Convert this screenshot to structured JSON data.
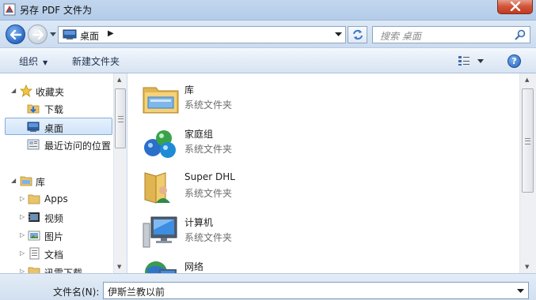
{
  "window": {
    "title": "另存 PDF 文件为"
  },
  "address": {
    "breadcrumb": "桌面",
    "search_placeholder": "搜索 桌面"
  },
  "toolbar": {
    "organize": "组织",
    "new_folder": "新建文件夹"
  },
  "nav": {
    "favorites_label": "收藏夹",
    "favorites": [
      {
        "label": "下载",
        "icon": "downloads-icon"
      },
      {
        "label": "桌面",
        "icon": "desktop-icon",
        "selected": true
      },
      {
        "label": "最近访问的位置",
        "icon": "recent-places-icon"
      }
    ],
    "libraries_label": "库",
    "libraries": [
      {
        "label": "Apps",
        "icon": "folder-icon"
      },
      {
        "label": "视频",
        "icon": "videos-icon"
      },
      {
        "label": "图片",
        "icon": "pictures-icon"
      },
      {
        "label": "文档",
        "icon": "documents-icon"
      },
      {
        "label": "迅雷下载",
        "icon": "folder-icon"
      }
    ]
  },
  "files": [
    {
      "name": "库",
      "type": "系统文件夹",
      "icon": "library-icon"
    },
    {
      "name": "家庭组",
      "type": "系统文件夹",
      "icon": "homegroup-icon"
    },
    {
      "name": "Super DHL",
      "type": "系统文件夹",
      "icon": "user-folder-icon"
    },
    {
      "name": "计算机",
      "type": "系统文件夹",
      "icon": "computer-icon"
    },
    {
      "name": "网络",
      "type": "",
      "icon": "network-icon"
    }
  ],
  "filename": {
    "label": "文件名(N):",
    "value": "伊斯兰教以前"
  }
}
